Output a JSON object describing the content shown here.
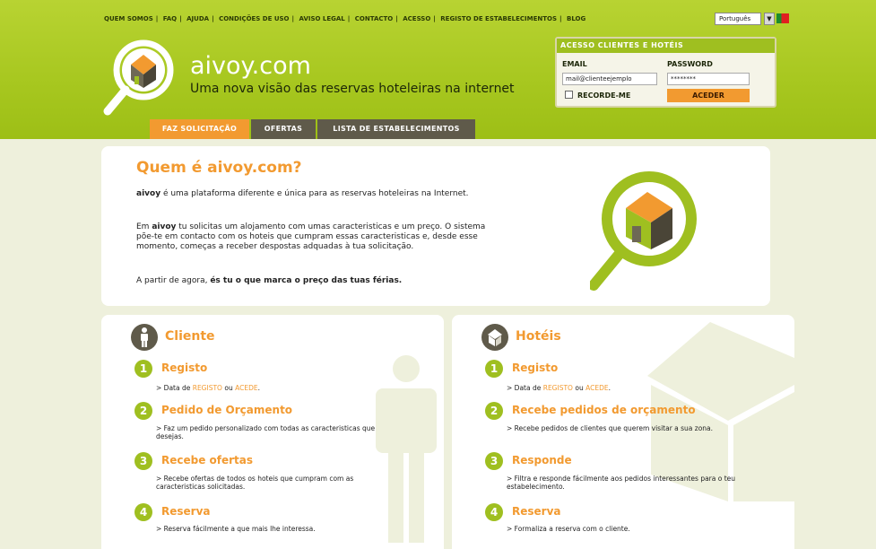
{
  "topnav": {
    "items": [
      "QUEM SOMOS",
      "FAQ",
      "AJUDA",
      "CONDIÇÕES DE USO",
      "AVISO LEGAL",
      "CONTACTO",
      "ACESSO",
      "REGISTO DE ESTABELECIMENTOS",
      "BLOG"
    ]
  },
  "language": {
    "selected": "Português"
  },
  "brand": {
    "site_name": "aivoy.com",
    "tagline": "Uma nova visão das reservas hoteleiras na internet"
  },
  "login": {
    "title": "ACESSO CLIENTES E HOTÉIS",
    "email_label": "EMAIL",
    "email_value": "mail@clienteejemplo",
    "password_label": "PASSWORD",
    "password_value": "********",
    "remember_label": "RECORDE-ME",
    "submit_label": "ACEDER"
  },
  "tabs": [
    "FAZ SOLICITAÇÃO",
    "OFERTAS",
    "LISTA DE ESTABELECIMENTOS"
  ],
  "about": {
    "title": "Quem é aivoy.com?",
    "p1_brand": "aivoy",
    "p1_rest": " é uma plataforma diferente e única para as reservas hoteleiras na Internet.",
    "p2_pre": "Em ",
    "p2_brand": "aivoy",
    "p2_rest": " tu solicitas um alojamento com umas caracteristicas e um preço. O sistema põe-te em contacto com os hoteis que cumpram essas caracteristicas e, desde esse momento, começas a receber despostas adquadas à tua solicitação.",
    "p3_pre": "A partir de agora, ",
    "p3_bold": "és tu o que marca o preço das tuas férias."
  },
  "cliente": {
    "title": "Cliente",
    "steps": [
      {
        "num": "1",
        "title": "Registo",
        "desc_pre": "> Data de ",
        "link1": "REGISTO",
        "mid": " ou ",
        "link2": "ACEDE",
        "end": "."
      },
      {
        "num": "2",
        "title": "Pedido de Orçamento",
        "desc": "> Faz um pedido personalizado com todas as caracteristicas que desejas."
      },
      {
        "num": "3",
        "title": "Recebe ofertas",
        "desc": "> Recebe ofertas de todos os hoteis que cumpram com as caracteristicas solicitadas."
      },
      {
        "num": "4",
        "title": "Reserva",
        "desc": "> Reserva fácilmente a que mais lhe interessa."
      }
    ]
  },
  "hoteis": {
    "title": "Hotéis",
    "steps": [
      {
        "num": "1",
        "title": "Registo",
        "desc_pre": "> Data de ",
        "link1": "REGISTO",
        "mid": " ou ",
        "link2": "ACEDE",
        "end": "."
      },
      {
        "num": "2",
        "title": "Recebe pedidos de orçamento",
        "desc": "> Recebe pedidos de clientes que querem visitar a sua zona."
      },
      {
        "num": "3",
        "title": "Responde",
        "desc": "> Filtra e responde fácilmente aos pedidos interessantes para o teu estabelecimento."
      },
      {
        "num": "4",
        "title": "Reserva",
        "desc": "> Formaliza a reserva com o cliente."
      }
    ]
  },
  "colors": {
    "brand_green": "#9fbf20",
    "accent_orange": "#f29a30",
    "dark": "#5f5a4a",
    "background": "#eef0dc"
  }
}
